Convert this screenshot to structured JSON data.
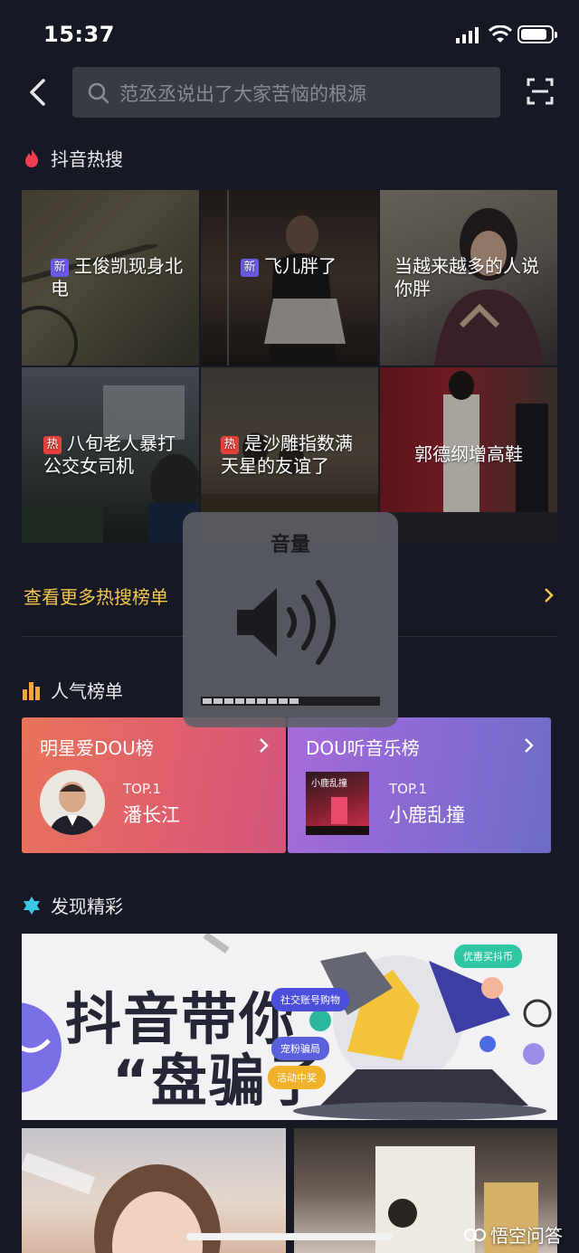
{
  "status": {
    "time": "15:37"
  },
  "search": {
    "placeholder": "范丞丞说出了大家苦恼的根源"
  },
  "hot_section": {
    "title": "抖音热搜",
    "tiles": [
      {
        "tag": "新",
        "tag_type": "new",
        "text": "王俊凯现身北电"
      },
      {
        "tag": "新",
        "tag_type": "new",
        "text": "飞儿胖了"
      },
      {
        "tag": "",
        "tag_type": "",
        "text": "当越来越多的人说你胖"
      },
      {
        "tag": "热",
        "tag_type": "hot",
        "text": "八旬老人暴打公交女司机"
      },
      {
        "tag": "热",
        "tag_type": "hot",
        "text": "是沙雕指数满天星的友谊了"
      },
      {
        "tag": "",
        "tag_type": "",
        "text": "郭德纲增高鞋"
      }
    ],
    "more_link": "查看更多热搜榜单"
  },
  "popular_section": {
    "title": "人气榜单",
    "cards": [
      {
        "title": "明星爱DOU榜",
        "rank": "TOP.1",
        "name": "潘长江"
      },
      {
        "title": "DOU听音乐榜",
        "rank": "TOP.1",
        "name": "小鹿乱撞",
        "album_text": "小鹿乱撞"
      }
    ]
  },
  "discover_section": {
    "title": "发现精彩",
    "banner": {
      "line1": "抖音带你",
      "line2": "“盘骗子",
      "pills": [
        "优惠买抖币",
        "社交账号购物",
        "宠粉骗局",
        "活动中奖"
      ]
    }
  },
  "volume_hud": {
    "title": "音量",
    "level": 0.55
  },
  "watermark": "悟空问答",
  "colors": {
    "background": "#161823",
    "accent_yellow": "#f3c64a",
    "tag_new": "#6a5ae8",
    "tag_hot": "#e5403b"
  }
}
